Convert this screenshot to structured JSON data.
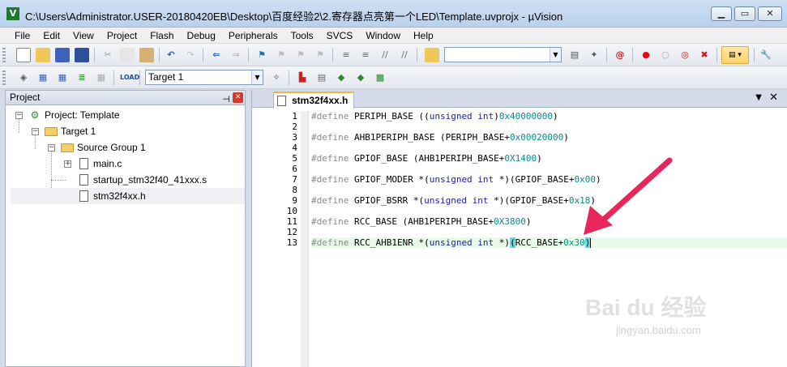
{
  "window": {
    "title": "C:\\Users\\Administrator.USER-20180420EB\\Desktop\\百度经验2\\2.寄存器点亮第一个LED\\Template.uvprojx - µVision",
    "app_icon": "V",
    "minimize": "▁",
    "maximize": "▭",
    "close": "✕"
  },
  "menu": [
    "File",
    "Edit",
    "View",
    "Project",
    "Flash",
    "Debug",
    "Peripherals",
    "Tools",
    "SVCS",
    "Window",
    "Help"
  ],
  "toolbar2": {
    "target_value": "Target 1"
  },
  "project_panel": {
    "title": "Project",
    "pin": "⊣",
    "close": "✕",
    "tree": {
      "root": "Project: Template",
      "target": "Target 1",
      "group": "Source Group 1",
      "files": [
        "main.c",
        "startup_stm32f40_41xxx.s",
        "stm32f4xx.h"
      ]
    }
  },
  "editor": {
    "tab_label": "stm32f4xx.h",
    "tab_menu": "▼",
    "tab_close": "✕",
    "line_numbers": [
      "1",
      "2",
      "3",
      "4",
      "5",
      "6",
      "7",
      "8",
      "9",
      "10",
      "11",
      "12",
      "13"
    ],
    "lines": [
      {
        "def": "#define",
        "rest": " PERIPH_BASE ((",
        "t1": "unsigned int",
        "mid": ")",
        "n1": "0x40000000",
        "end": ")"
      },
      {
        "def": "",
        "rest": "",
        "t1": "",
        "mid": "",
        "n1": "",
        "end": ""
      },
      {
        "def": "#define",
        "rest": " AHB1PERIPH_BASE (PERIPH_BASE+",
        "t1": "",
        "mid": "",
        "n1": "0x00020000",
        "end": ")"
      },
      {
        "def": "",
        "rest": "",
        "t1": "",
        "mid": "",
        "n1": "",
        "end": ""
      },
      {
        "def": "#define",
        "rest": " GPIOF_BASE (AHB1PERIPH_BASE+",
        "t1": "",
        "mid": "",
        "n1": "0X1400",
        "end": ")"
      },
      {
        "def": "",
        "rest": "",
        "t1": "",
        "mid": "",
        "n1": "",
        "end": ""
      },
      {
        "def": "#define",
        "rest": " GPIOF_MODER *(",
        "t1": "unsigned int",
        "mid": " *)(GPIOF_BASE+",
        "n1": "0x00",
        "end": ")"
      },
      {
        "def": "",
        "rest": "",
        "t1": "",
        "mid": "",
        "n1": "",
        "end": ""
      },
      {
        "def": "#define",
        "rest": " GPIOF_BSRR *(",
        "t1": "unsigned int",
        "mid": " *)(GPIOF_BASE+",
        "n1": "0x18",
        "end": ")"
      },
      {
        "def": "",
        "rest": "",
        "t1": "",
        "mid": "",
        "n1": "",
        "end": ""
      },
      {
        "def": "#define",
        "rest": " RCC_BASE (AHB1PERIPH_BASE+",
        "t1": "",
        "mid": "",
        "n1": "0X3800",
        "end": ")"
      },
      {
        "def": "",
        "rest": "",
        "t1": "",
        "mid": "",
        "n1": "",
        "end": ""
      },
      {
        "def": "#define",
        "rest": " RCC_AHB1ENR *(",
        "t1": "unsigned int",
        "mid": " *)",
        "n1": "",
        "end": ""
      }
    ],
    "last_line_tail": {
      "open": "(",
      "body": "RCC_BASE+",
      "num": "0x30",
      "close": ")"
    }
  },
  "watermark": {
    "brand": "Bai du 经验",
    "url": "jingyan.baidu.com"
  },
  "colors": {
    "arrow": "#e8265a",
    "current_line": "#e8fae8",
    "paren_highlight": "#5fe0e0",
    "keyword_type": "#1a1ab0",
    "number": "#0a8a8a"
  }
}
